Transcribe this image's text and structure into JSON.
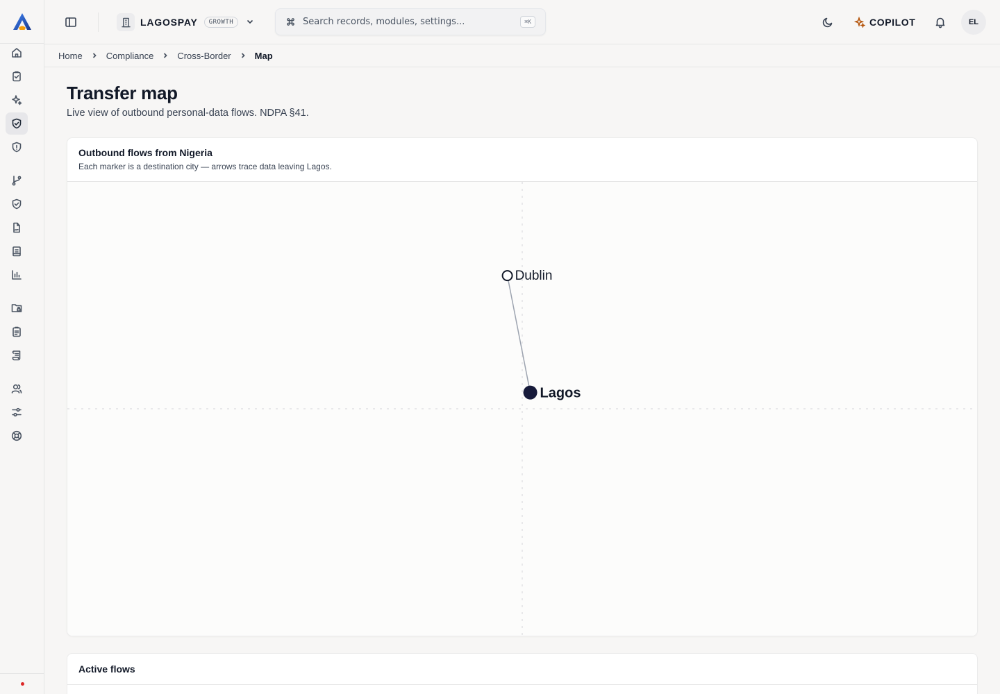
{
  "topbar": {
    "workspace_name": "LAGOSPAY",
    "workspace_plan": "GROWTH",
    "search_placeholder": "Search records, modules, settings...",
    "search_shortcut": "⌘K",
    "copilot_label": "COPILOT",
    "avatar_initials": "EL"
  },
  "breadcrumb": [
    "Home",
    "Compliance",
    "Cross-Border",
    "Map"
  ],
  "page": {
    "title": "Transfer map",
    "subtitle": "Live view of outbound personal-data flows. NDPA §41."
  },
  "map_card": {
    "title": "Outbound flows from Nigeria",
    "description": "Each marker is a destination city — arrows trace data leaving Lagos.",
    "origin": {
      "name": "Lagos",
      "lat": 6.5,
      "lon": 3.4
    },
    "destinations": [
      {
        "name": "Dublin",
        "lat": 53.3,
        "lon": -6.3
      }
    ]
  },
  "flows_card": {
    "title": "Active flows"
  },
  "colors": {
    "origin_marker": "#161a3a",
    "route_line": "#9ca3af",
    "alert_dot": "#dc2626",
    "copilot_accent": "#b45309"
  }
}
